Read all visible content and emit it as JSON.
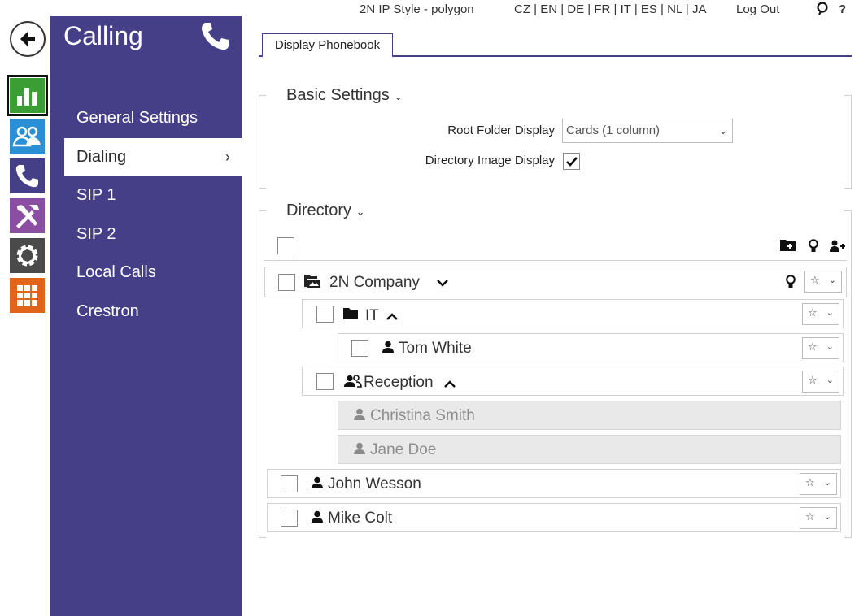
{
  "topbar": {
    "device": "2N IP Style - polygon",
    "languages": "CZ | EN | DE | FR | IT | ES | NL | JA",
    "logout": "Log Out",
    "help": "?"
  },
  "menu": {
    "title": "Calling",
    "items": [
      "General Settings",
      "Dialing",
      "SIP 1",
      "SIP 2",
      "Local Calls",
      "Crestron"
    ],
    "active_index": 1,
    "chevron": "›"
  },
  "rail": {
    "icons": [
      "back-arrow-icon",
      "status-chart-icon",
      "directory-users-icon",
      "calling-phone-icon",
      "hardware-tools-icon",
      "system-gear-icon",
      "services-grid-icon"
    ],
    "colors": {
      "status": "#3a9e35",
      "directory": "#2b8fd6",
      "calling": "#443f87",
      "hardware": "#8a4fa3",
      "system": "#4a4a4a",
      "services": "#e0641a"
    }
  },
  "tabs": {
    "display_phonebook": "Display Phonebook"
  },
  "basic_settings": {
    "legend": "Basic Settings",
    "root_folder_label": "Root Folder Display",
    "root_folder_value": "Cards (1 column)",
    "image_display_label": "Directory Image Display",
    "image_display_checked": true
  },
  "directory": {
    "legend": "Directory",
    "rows": [
      {
        "name": "2N Company",
        "type": "folder-root"
      },
      {
        "name": "IT",
        "type": "folder"
      },
      {
        "name": "Tom White",
        "type": "user"
      },
      {
        "name": "Reception",
        "type": "group"
      },
      {
        "name": "Christina Smith",
        "type": "user-disabled"
      },
      {
        "name": "Jane Doe",
        "type": "user-disabled"
      },
      {
        "name": "John Wesson",
        "type": "user"
      },
      {
        "name": "Mike Colt",
        "type": "user"
      }
    ],
    "star_symbol": "☆",
    "dropdown_symbol": "⌄"
  },
  "accent_color": "#443f87"
}
